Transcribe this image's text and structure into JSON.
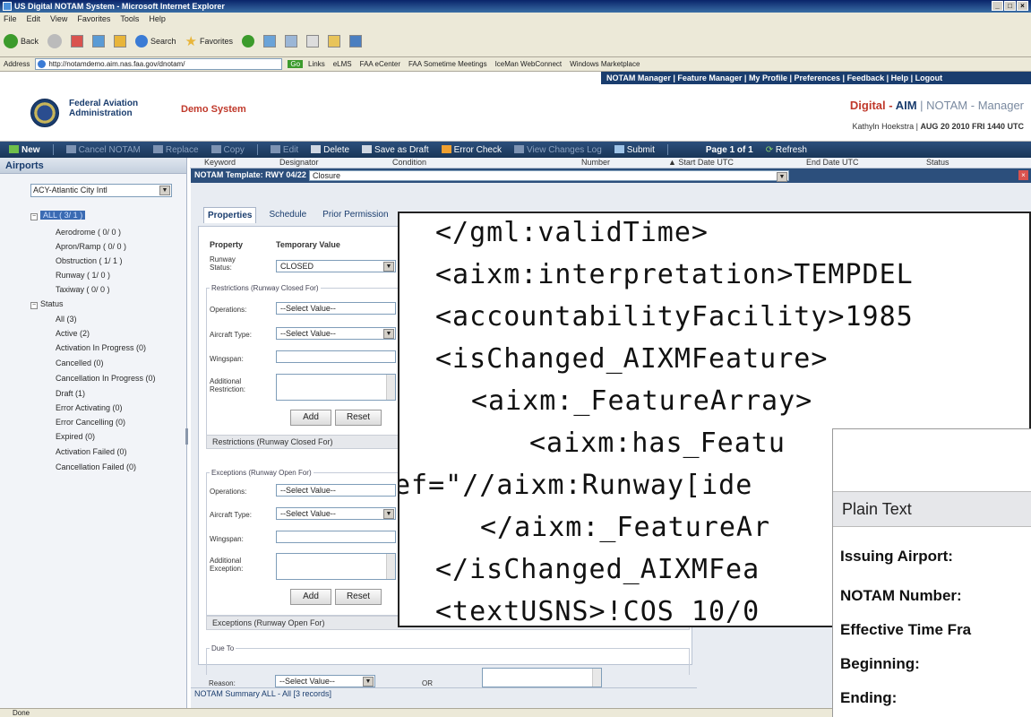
{
  "window": {
    "title": "US Digital NOTAM System - Microsoft Internet Explorer",
    "buttons": [
      "_",
      "□",
      "×"
    ]
  },
  "menu": [
    "File",
    "Edit",
    "View",
    "Favorites",
    "Tools",
    "Help"
  ],
  "ie_toolbar": {
    "back": "Back",
    "search": "Search",
    "favorites": "Favorites"
  },
  "addressbar": {
    "label": "Address",
    "url": "http://notamdemo.aim.nas.faa.gov/dnotam/",
    "go": "Go",
    "links_label": "Links",
    "links": [
      "eLMS",
      "FAA eCenter",
      "FAA Sometime Meetings",
      "IceMan WebConnect",
      "Windows Marketplace"
    ]
  },
  "header": {
    "topnav": [
      "NOTAM Manager",
      "Feature Manager",
      "My Profile",
      "Preferences",
      "Feedback",
      "Help",
      "Logout"
    ],
    "org_line1": "Federal Aviation",
    "org_line2": "Administration",
    "demo": "Demo System",
    "brand_digital": "Digital",
    "brand_sep": " - ",
    "brand_aim": "AIM",
    "brand_mgr": " | NOTAM - Manager",
    "user": "Kathyln Hoekstra |",
    "datetime": "AUG 20 2010 FRI 1440 UTC"
  },
  "app_toolbar": {
    "new": "New",
    "cancel": "Cancel NOTAM",
    "replace": "Replace",
    "copy": "Copy",
    "edit": "Edit",
    "delete": "Delete",
    "save_draft": "Save as Draft",
    "error_check": "Error Check",
    "view_changes": "View Changes Log",
    "submit": "Submit",
    "page": "Page 1 of 1",
    "refresh": "Refresh"
  },
  "sidebar": {
    "title": "Airports",
    "airport": "ACY-Atlantic City Intl",
    "all_label": "ALL ( 3/ 1 )",
    "categories": [
      "Aerodrome ( 0/ 0 )",
      "Apron/Ramp ( 0/ 0 )",
      "Obstruction ( 1/ 1 )",
      "Runway ( 1/ 0 )",
      "Taxiway ( 0/ 0 )"
    ],
    "status_label": "Status",
    "statuses": [
      "All (3)",
      "Active (2)",
      "Activation In Progress (0)",
      "Cancelled (0)",
      "Cancellation In Progress (0)",
      "Draft (1)",
      "Error Activating (0)",
      "Error Cancelling (0)",
      "Expired (0)",
      "Activation Failed (0)",
      "Cancellation Failed (0)"
    ]
  },
  "columns": [
    "Keyword",
    "Designator",
    "Condition",
    "Number",
    "▲ Start Date UTC",
    "End Date UTC",
    "Status"
  ],
  "template": {
    "label": "NOTAM Template: RWY 04/22",
    "value": "Closure"
  },
  "tabs": [
    "Properties",
    "Schedule",
    "Prior Permission"
  ],
  "form": {
    "col_property": "Property",
    "col_temp": "Temporary Value",
    "runway_status_label": "Runway Status:",
    "runway_status_value": "CLOSED",
    "restrictions_legend": "Restrictions (Runway Closed For)",
    "operations_label": "Operations:",
    "select_value": "--Select Value--",
    "aircraft_type_label": "Aircraft Type:",
    "wingspan_label": "Wingspan:",
    "additional_restriction_label": "Additional Restriction:",
    "add": "Add",
    "reset": "Reset",
    "restrictions_header": "Restrictions (Runway Closed For)",
    "exceptions_legend": "Exceptions (Runway Open For)",
    "additional_exception_label": "Additional Exception:",
    "exceptions_header": "Exceptions (Runway Open For)",
    "due_to_legend": "Due To",
    "reason_label": "Reason:",
    "or": "OR"
  },
  "summary": "NOTAM Summary ALL - All [3 records]",
  "status_bar": "Done",
  "xml_lines": [
    "</gml:validTime>",
    "<aixm:interpretation>TEMPDEL",
    "<accountabilityFacility>1985",
    "<isChanged_AIXMFeature>",
    "<aixm:_FeatureArray>",
    "<aixm:has_Featu",
    "ef=\"//aixm:Runway[ide",
    "</aixm:_FeatureAr",
    "</isChanged_AIXMFea",
    "<textUSNS>!COS 10/0"
  ],
  "plain_text": {
    "title": "Plain Text",
    "fields": [
      "Issuing Airport:",
      "NOTAM Number:",
      "Effective Time Fra",
      "Beginning:",
      "Ending:"
    ]
  }
}
